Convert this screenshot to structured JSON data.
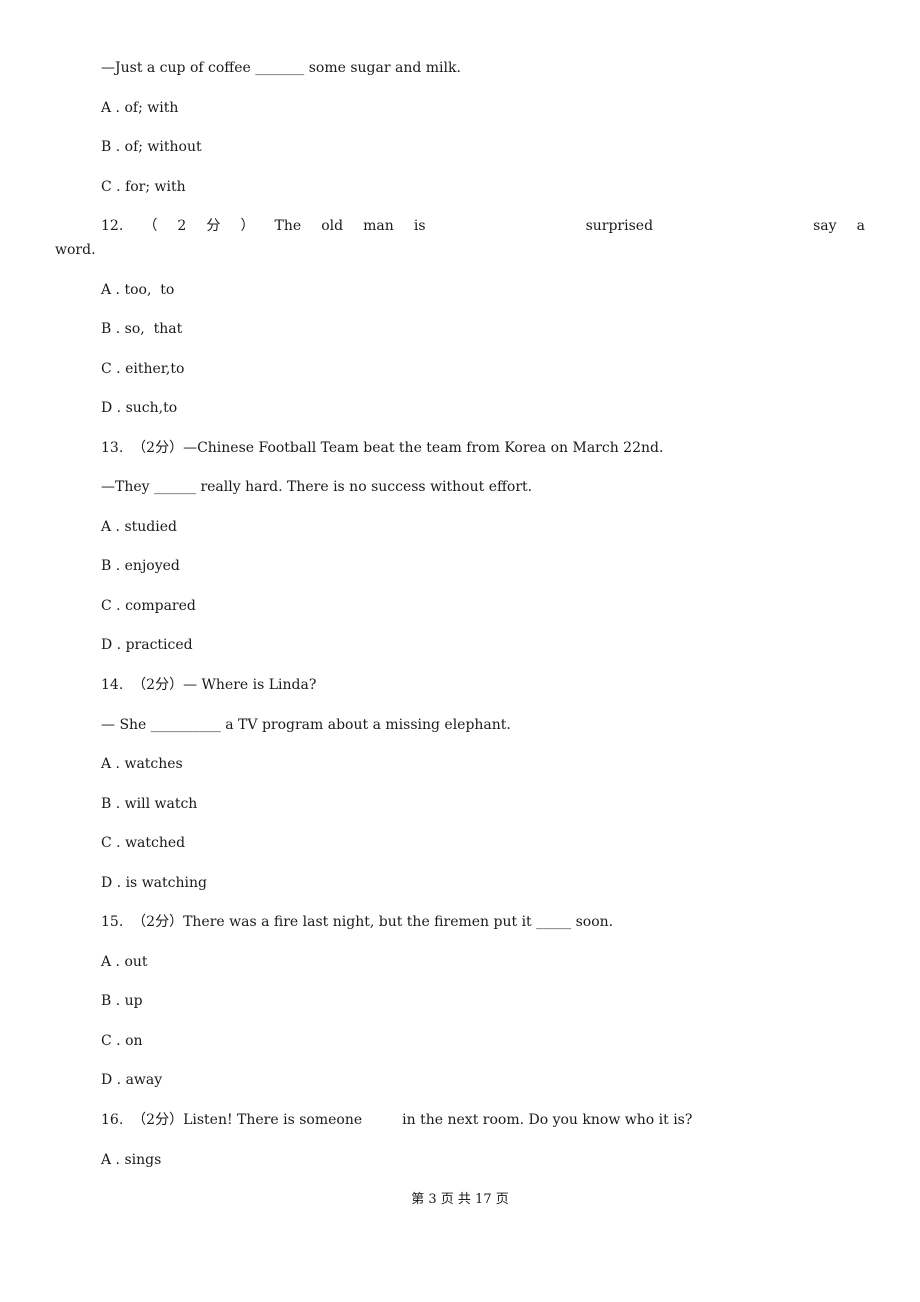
{
  "page": {
    "lines": [
      {
        "text": "—Just a cup of coffee _______ some sugar and milk."
      },
      {
        "text": "A . of; with"
      },
      {
        "text": "B . of; without"
      },
      {
        "text": "C . for; with"
      }
    ],
    "q12": {
      "words": [
        "12.",
        "（",
        "2",
        "分",
        "）",
        "The",
        "old",
        "man",
        "is",
        "surprised",
        "say",
        "a"
      ],
      "wrap": "word.",
      "options": [
        "A . too,  to",
        "B . so,  that",
        "C . either,to",
        "D . such,to"
      ]
    },
    "q13": {
      "stem": "13.  （2分）—Chinese Football Team beat the team from Korea on March 22nd.",
      "line2": "—They ______ really hard. There is no success without effort.",
      "options": [
        "A . studied",
        "B . enjoyed",
        "C . compared",
        "D . practiced"
      ]
    },
    "q14": {
      "stem": "14.  （2分）— Where is Linda?",
      "line2": "— She __________ a TV program about a missing elephant.",
      "options": [
        "A . watches",
        "B . will watch",
        "C . watched",
        "D . is watching"
      ]
    },
    "q15": {
      "stem": "15.  （2分）There was a fire last night, but the firemen put it _____ soon.",
      "options": [
        "A . out",
        "B . up",
        "C . on",
        "D . away"
      ]
    },
    "q16": {
      "stem": "16.  （2分）Listen! There is someone         in the next room. Do you know who it is?",
      "options": [
        "A . sings"
      ]
    },
    "footer": "第 3 页 共 17 页"
  }
}
